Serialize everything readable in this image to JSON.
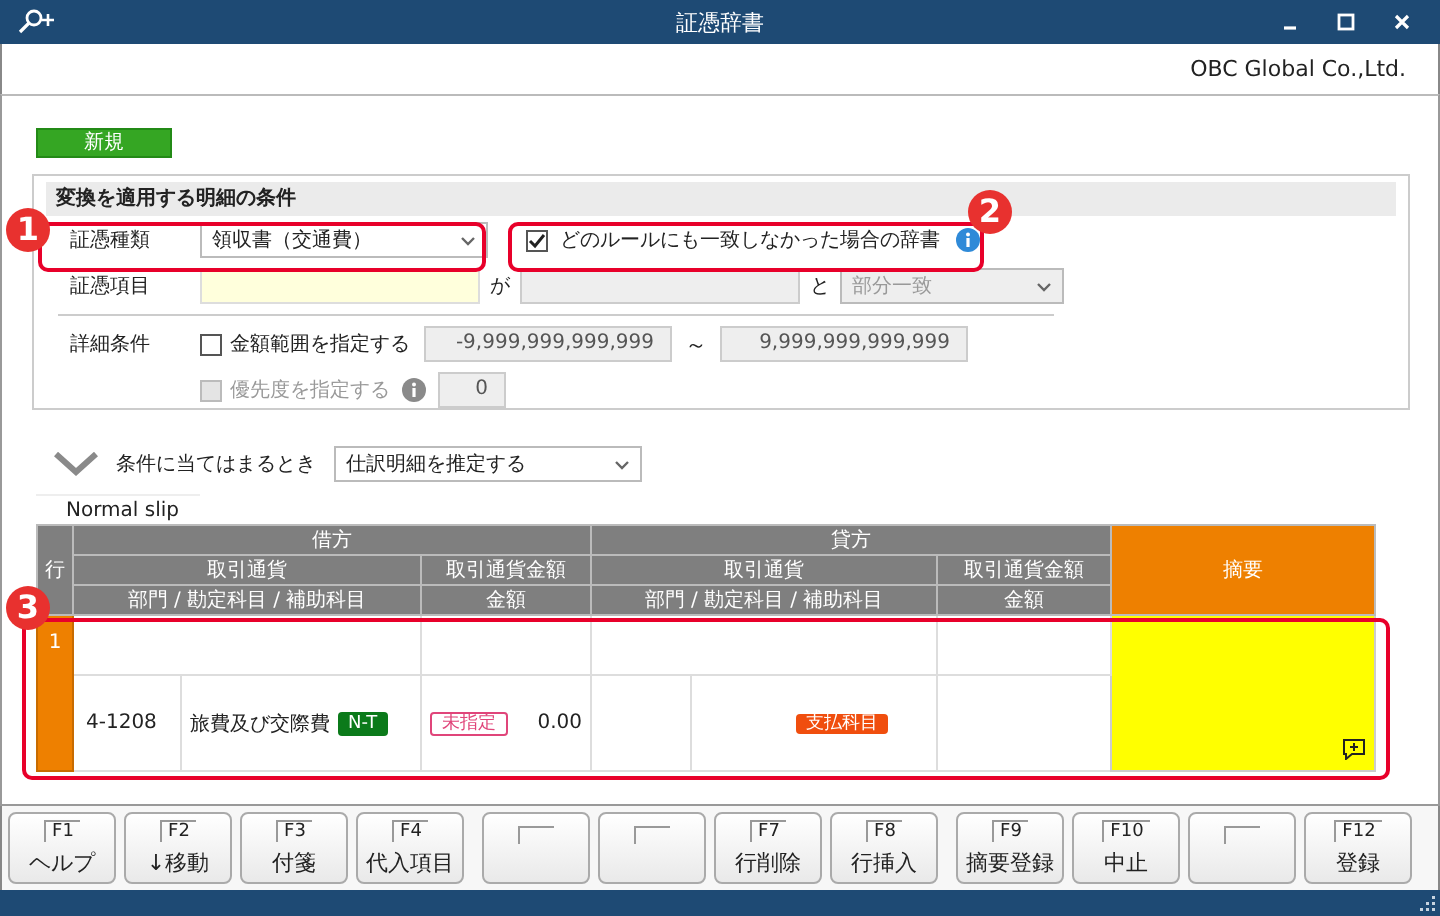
{
  "window": {
    "title": "証憑辞書",
    "company": "OBC Global Co.,Ltd."
  },
  "new_badge": "新規",
  "conditions": {
    "heading": "変換を適用する明細の条件",
    "voucher_type": {
      "label": "証憑種類",
      "value": "領収書（交通費）"
    },
    "fallback": {
      "label": "どのルールにも一致しなかった場合の辞書",
      "checked": true
    },
    "voucher_item": {
      "label": "証憑項目",
      "connector_1": "が",
      "connector_2": "と",
      "match": "部分一致"
    },
    "detail": {
      "label": "詳細条件",
      "amount_range": {
        "label": "金額範囲を指定する",
        "checked": false,
        "min": "-9,999,999,999,999",
        "separator": "～",
        "max": "9,999,999,999,999"
      },
      "priority": {
        "label": "優先度を指定する",
        "checked": false,
        "disabled": true,
        "value": "0"
      }
    }
  },
  "when_matched": {
    "label": "条件に当てはまるとき",
    "value": "仕訳明細を推定する"
  },
  "slip_tab": "Normal slip",
  "grid": {
    "row_header": "行",
    "debit": {
      "title": "借方",
      "currency": "取引通貨",
      "currency_amount": "取引通貨金額",
      "account": "部門 / 勘定科目 / 補助科目",
      "amount": "金額"
    },
    "credit": {
      "title": "貸方",
      "currency": "取引通貨",
      "currency_amount": "取引通貨金額",
      "account": "部門 / 勘定科目 / 補助科目",
      "amount": "金額"
    },
    "summary": "摘要",
    "rows": [
      {
        "number": "1",
        "debit_code": "4-1208",
        "debit_account": "旅費及び交際費",
        "debit_tag": "N-T",
        "debit_tax": "未指定",
        "debit_amount": "0.00",
        "credit_tag": "支払科目",
        "has_comment": true
      }
    ]
  },
  "function_keys": [
    {
      "kind": "key",
      "key": "F1",
      "label": "ヘルプ"
    },
    {
      "kind": "key",
      "key": "F2",
      "label": "↓移動"
    },
    {
      "kind": "key",
      "key": "F3",
      "label": "付箋"
    },
    {
      "kind": "key",
      "key": "F4",
      "label": "代入項目"
    },
    {
      "kind": "blank"
    },
    {
      "kind": "blank"
    },
    {
      "kind": "key",
      "key": "F7",
      "label": "行削除"
    },
    {
      "kind": "key",
      "key": "F8",
      "label": "行挿入"
    },
    {
      "kind": "key",
      "key": "F9",
      "label": "摘要登録"
    },
    {
      "kind": "key",
      "key": "F10",
      "label": "中止"
    },
    {
      "kind": "blank"
    },
    {
      "kind": "key",
      "key": "F12",
      "label": "登録"
    }
  ],
  "annotations": [
    {
      "number": "1"
    },
    {
      "number": "2"
    },
    {
      "number": "3"
    }
  ]
}
